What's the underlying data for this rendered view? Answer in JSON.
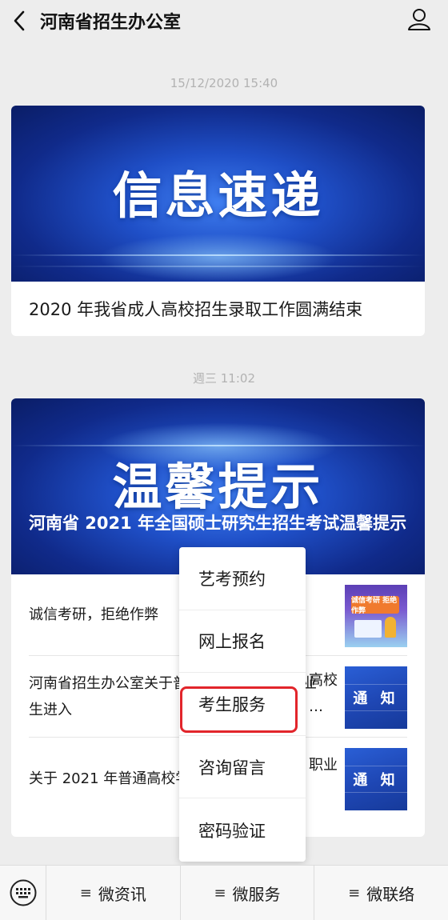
{
  "header": {
    "title": "河南省招生办公室",
    "back_icon": "chevron-left-icon",
    "profile_icon": "person-icon"
  },
  "messages": [
    {
      "timestamp": "15/12/2020 15:40",
      "banner_text": "信息速递",
      "caption": "2020 年我省成人高校招生录取工作圆满结束"
    },
    {
      "timestamp": "週三 11:02",
      "banner_text": "温馨提示",
      "overlay_title": "河南省 2021 年全国硕士研究生招生考试温馨提示",
      "items": [
        {
          "text": "诚信考研，拒绝作弊",
          "thumb_label": "诚信考研 拒绝作弊"
        },
        {
          "text": "河南省招生办公室关于普通高校专科应届毕业生进入",
          "text_right": "高校",
          "text_right2": "…",
          "thumb_label": "通 知"
        },
        {
          "text": "关于 2021 年普通高校学校毕业生报名信息",
          "text_right": "职业",
          "thumb_label": "通 知"
        }
      ]
    }
  ],
  "popup_menu": {
    "items": [
      "艺考预约",
      "网上报名",
      "考生服务",
      "咨询留言",
      "密码验证"
    ],
    "highlighted": "考生服务",
    "highlight_color": "#e2252b"
  },
  "bottom_menu": {
    "keyboard_icon": "keyboard-icon",
    "tabs": [
      "微资讯",
      "微服务",
      "微联络"
    ],
    "tab_icon": "≡"
  }
}
